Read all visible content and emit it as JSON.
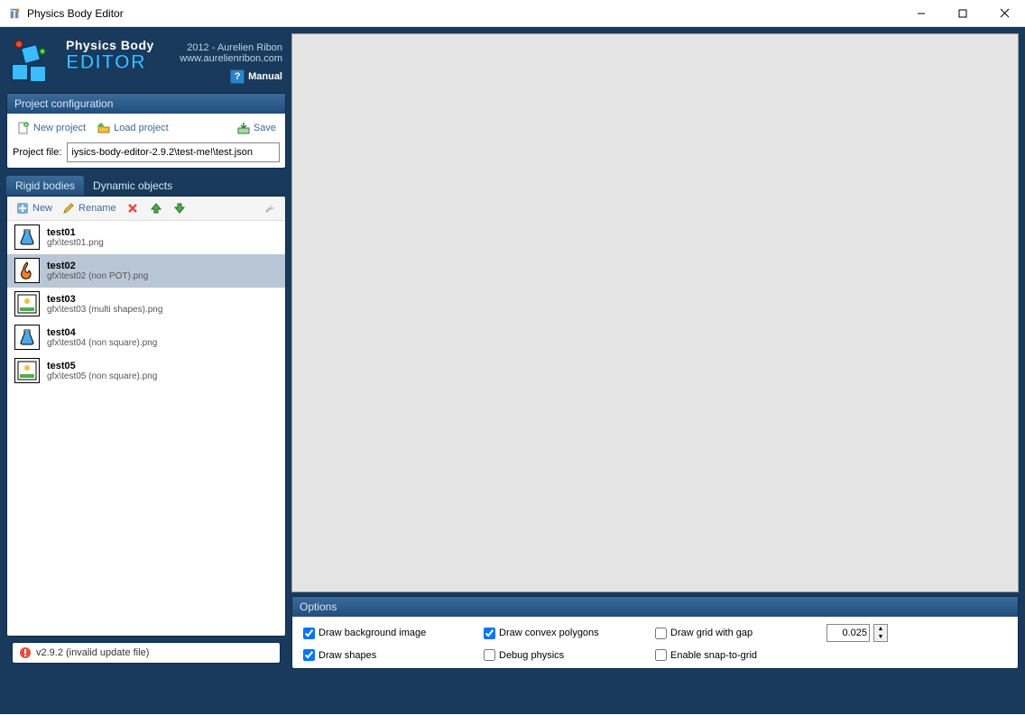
{
  "window": {
    "title": "Physics Body Editor"
  },
  "logo": {
    "line1": "Physics Body",
    "line2": "EDITOR"
  },
  "meta": {
    "year_author": "2012 - Aurelien Ribon",
    "url": "www.aurelienribon.com"
  },
  "manual": {
    "label": "Manual"
  },
  "project_config": {
    "header": "Project configuration",
    "new_label": "New project",
    "load_label": "Load project",
    "save_label": "Save",
    "file_label": "Project file:",
    "file_value": "iysics-body-editor-2.9.2\\test-me!\\test.json"
  },
  "tabs": {
    "rigid": "Rigid bodies",
    "dynamic": "Dynamic objects"
  },
  "body_toolbar": {
    "new": "New",
    "rename": "Rename"
  },
  "bodies": [
    {
      "name": "test01",
      "path": "gfx\\test01.png",
      "thumb": "flask-blue",
      "selected": false
    },
    {
      "name": "test02",
      "path": "gfx\\test02 (non POT).png",
      "thumb": "flame-orange",
      "selected": true
    },
    {
      "name": "test03",
      "path": "gfx\\test03 (multi shapes).png",
      "thumb": "landscape",
      "selected": false
    },
    {
      "name": "test04",
      "path": "gfx\\test04 (non square).png",
      "thumb": "flask-blue",
      "selected": false
    },
    {
      "name": "test05",
      "path": "gfx\\test05 (non square).png",
      "thumb": "landscape",
      "selected": false
    }
  ],
  "options": {
    "header": "Options",
    "draw_bg": {
      "label": "Draw background image",
      "checked": true
    },
    "draw_convex": {
      "label": "Draw convex polygons",
      "checked": true
    },
    "draw_grid": {
      "label": "Draw grid with gap",
      "checked": false
    },
    "gap_value": "0.025",
    "draw_shapes": {
      "label": "Draw shapes",
      "checked": true
    },
    "debug_physics": {
      "label": "Debug physics",
      "checked": false
    },
    "snap": {
      "label": "Enable snap-to-grid",
      "checked": false
    }
  },
  "status": {
    "text": "v2.9.2 (invalid update file)"
  }
}
